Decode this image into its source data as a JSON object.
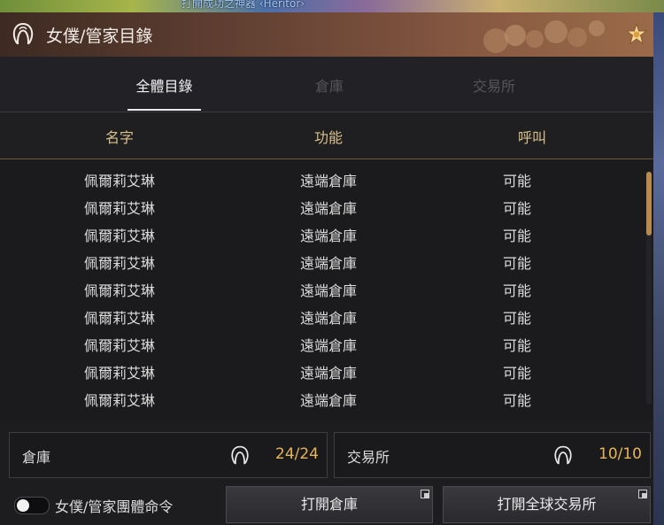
{
  "background": {
    "caption": "打開成功之神器 ‹Heritor›"
  },
  "window": {
    "title": "女僕/管家目錄",
    "title_icon": "maid-hair-icon",
    "corner_icon": "flower-star-icon"
  },
  "tabs": [
    {
      "label": "全體目錄",
      "active": true
    },
    {
      "label": "倉庫",
      "active": false
    },
    {
      "label": "交易所",
      "active": false
    }
  ],
  "columns": [
    "名字",
    "功能",
    "呼叫"
  ],
  "rows": [
    {
      "name": "佩爾莉艾琳",
      "function": "遠端倉庫",
      "call": "可能"
    },
    {
      "name": "佩爾莉艾琳",
      "function": "遠端倉庫",
      "call": "可能"
    },
    {
      "name": "佩爾莉艾琳",
      "function": "遠端倉庫",
      "call": "可能"
    },
    {
      "name": "佩爾莉艾琳",
      "function": "遠端倉庫",
      "call": "可能"
    },
    {
      "name": "佩爾莉艾琳",
      "function": "遠端倉庫",
      "call": "可能"
    },
    {
      "name": "佩爾莉艾琳",
      "function": "遠端倉庫",
      "call": "可能"
    },
    {
      "name": "佩爾莉艾琳",
      "function": "遠端倉庫",
      "call": "可能"
    },
    {
      "name": "佩爾莉艾琳",
      "function": "遠端倉庫",
      "call": "可能"
    },
    {
      "name": "佩爾莉艾琳",
      "function": "遠端倉庫",
      "call": "可能"
    }
  ],
  "summary": {
    "warehouse": {
      "label": "倉庫",
      "count": "24/24"
    },
    "market": {
      "label": "交易所",
      "count": "10/10"
    }
  },
  "footer": {
    "toggle_label": "女僕/管家團體命令",
    "toggle_on": false,
    "open_warehouse": "打開倉庫",
    "open_market": "打開全球交易所"
  },
  "colors": {
    "accent": "#e8b45a",
    "header_text": "#d8c08a",
    "scroll_thumb": "#b88a50"
  }
}
